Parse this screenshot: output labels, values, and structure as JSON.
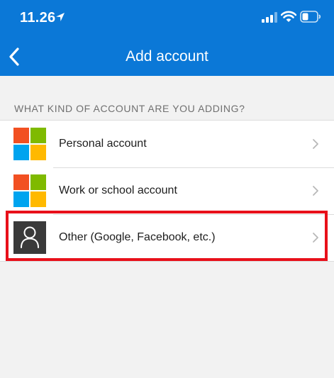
{
  "status_bar": {
    "time": "11.26"
  },
  "header": {
    "title": "Add account"
  },
  "section": {
    "label": "WHAT KIND OF ACCOUNT ARE YOU ADDING?"
  },
  "accounts": [
    {
      "label": "Personal account",
      "icon": "microsoft-logo-icon"
    },
    {
      "label": "Work or school account",
      "icon": "microsoft-logo-icon"
    },
    {
      "label": "Other (Google, Facebook, etc.)",
      "icon": "person-icon"
    }
  ],
  "colors": {
    "header_bg": "#0b78d7",
    "highlight": "#e8101a",
    "ms_red": "#f25022",
    "ms_green": "#7fba00",
    "ms_blue": "#00a4ef",
    "ms_yellow": "#ffb900"
  },
  "highlighted_item": "Other (Google, Facebook, etc.)"
}
